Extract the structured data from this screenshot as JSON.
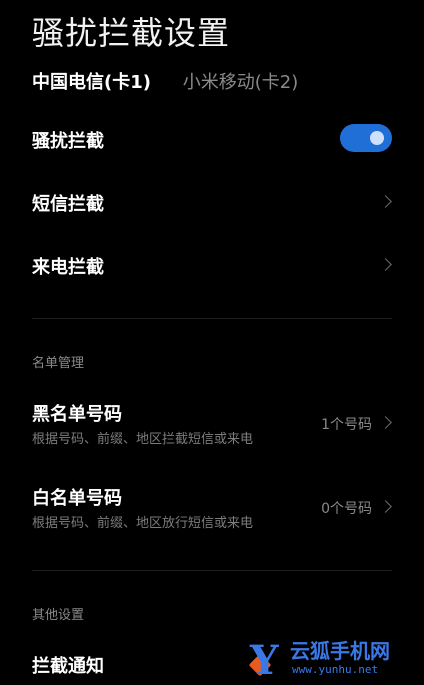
{
  "page": {
    "title": "骚扰拦截设置"
  },
  "sim_tabs": [
    {
      "label": "中国电信(卡1)",
      "active": true
    },
    {
      "label": "小米移动(卡2)",
      "active": false
    }
  ],
  "settings": {
    "harass_block": {
      "label": "骚扰拦截",
      "enabled": true
    },
    "sms_block": {
      "label": "短信拦截"
    },
    "call_block": {
      "label": "来电拦截"
    }
  },
  "lists_section": {
    "header": "名单管理",
    "blacklist": {
      "label": "黑名单号码",
      "desc": "根据号码、前缀、地区拦截短信或来电",
      "count": "1个号码"
    },
    "whitelist": {
      "label": "白名单号码",
      "desc": "根据号码、前缀、地区放行短信或来电",
      "count": "0个号码"
    }
  },
  "other_section": {
    "header": "其他设置",
    "block_notify": {
      "label": "拦截通知"
    }
  },
  "watermark": {
    "brand": "云狐手机网",
    "url": "www.yunhu.net"
  },
  "colors": {
    "accent": "#1f6fd6",
    "background": "#000000"
  }
}
